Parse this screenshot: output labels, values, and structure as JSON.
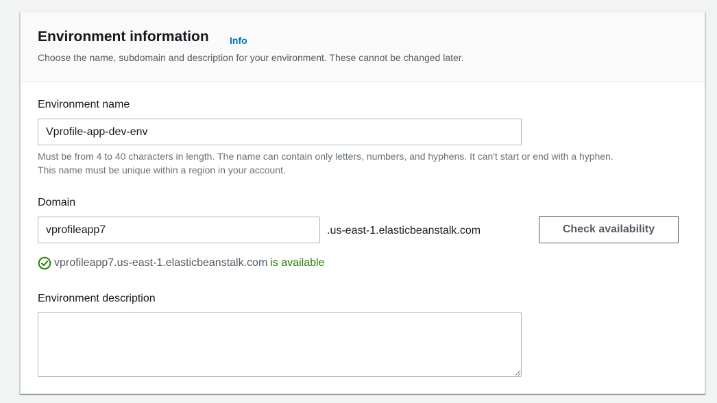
{
  "section": {
    "title": "Environment information",
    "info_link": "Info",
    "description": "Choose the name, subdomain and description for your environment. These cannot be changed later."
  },
  "env_name": {
    "label": "Environment name",
    "value": "Vprofile-app-dev-env",
    "hint_line1": "Must be from 4 to 40 characters in length. The name can contain only letters, numbers, and hyphens. It can't start or end with a hyphen.",
    "hint_line2": "This name must be unique within a region in your account."
  },
  "domain": {
    "label": "Domain",
    "value": "vprofileapp7",
    "suffix": ".us-east-1.elasticbeanstalk.com",
    "check_button": "Check availability",
    "status_icon": "check-circle-icon",
    "status_domain": "vprofileapp7.us-east-1.elasticbeanstalk.com",
    "status_text": "is available"
  },
  "env_description": {
    "label": "Environment description",
    "value": ""
  },
  "colors": {
    "link": "#0073bb",
    "success": "#1d8102",
    "text": "#16191f",
    "muted": "#687078"
  }
}
